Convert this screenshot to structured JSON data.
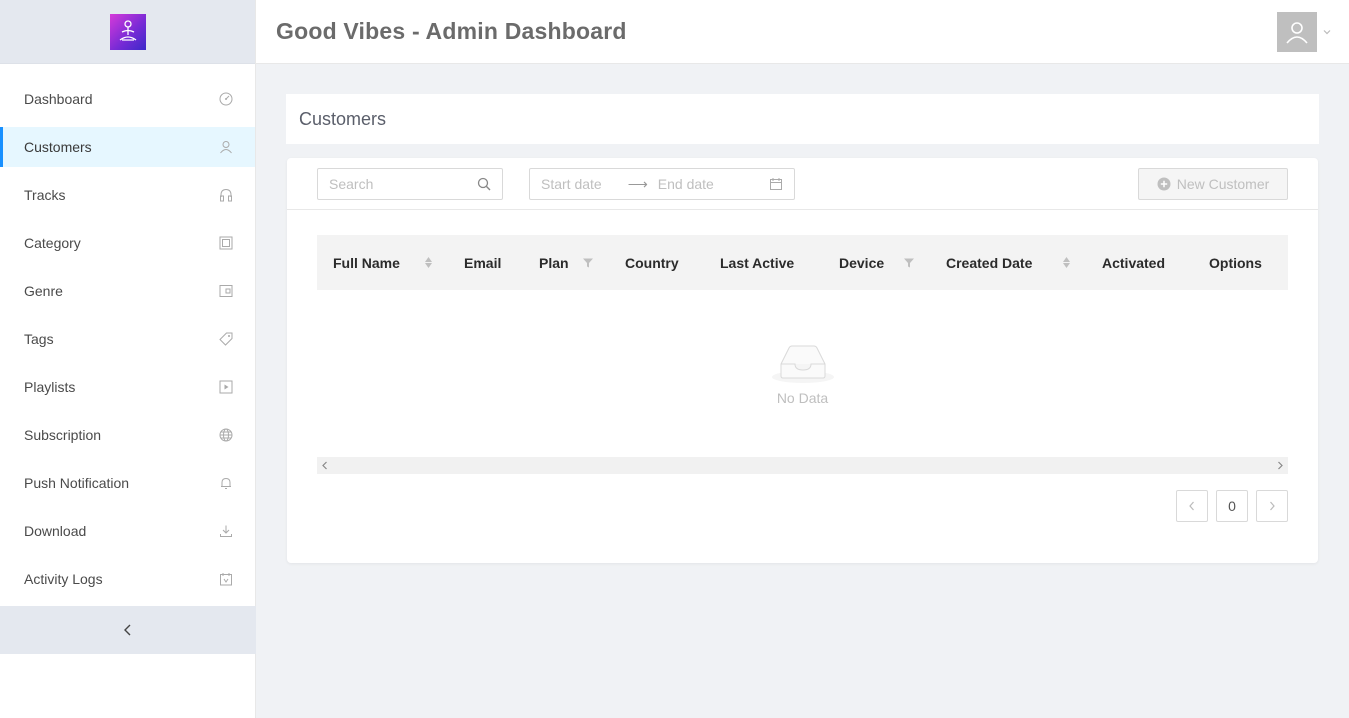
{
  "app": {
    "title": "Good Vibes - Admin Dashboard"
  },
  "sidebar": {
    "items": [
      {
        "label": "Dashboard",
        "icon": "dashboard-icon"
      },
      {
        "label": "Customers",
        "icon": "user-icon",
        "active": true
      },
      {
        "label": "Tracks",
        "icon": "headphones-icon"
      },
      {
        "label": "Category",
        "icon": "category-icon"
      },
      {
        "label": "Genre",
        "icon": "genre-icon"
      },
      {
        "label": "Tags",
        "icon": "tag-icon"
      },
      {
        "label": "Playlists",
        "icon": "play-square-icon"
      },
      {
        "label": "Subscription",
        "icon": "globe-icon"
      },
      {
        "label": "Push Notification",
        "icon": "bell-icon"
      },
      {
        "label": "Download",
        "icon": "download-icon"
      },
      {
        "label": "Activity Logs",
        "icon": "calendar-icon"
      }
    ]
  },
  "page": {
    "title": "Customers"
  },
  "toolbar": {
    "search_placeholder": "Search",
    "start_placeholder": "Start date",
    "end_placeholder": "End date",
    "new_button": "New Customer"
  },
  "table": {
    "columns": [
      "Full Name",
      "Email",
      "Plan",
      "Country",
      "Last Active",
      "Device",
      "Created Date",
      "Activated",
      "Options"
    ],
    "empty_text": "No Data"
  },
  "pagination": {
    "current": "0"
  },
  "colors": {
    "accent": "#1890ff",
    "active_bg": "#e6f7ff",
    "logo_from": "#d63ad9",
    "logo_to": "#3b28c9"
  }
}
